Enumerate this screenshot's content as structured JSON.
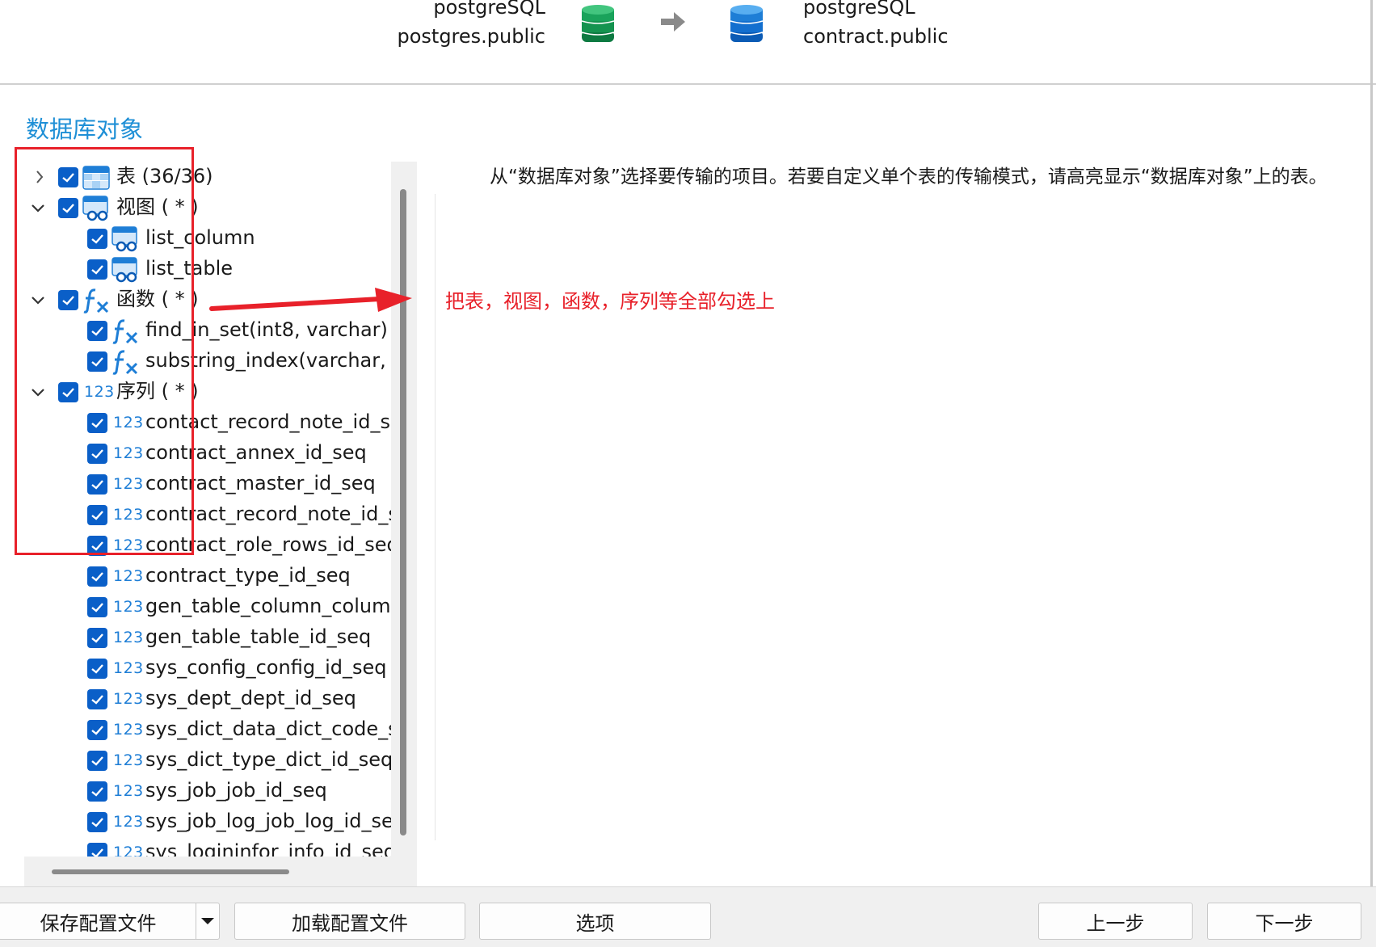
{
  "header": {
    "source_server": "postgreSQL",
    "source_schema": "postgres.public",
    "target_server": "postgreSQL",
    "target_schema": "contract.public",
    "source_color": "#1aa35b",
    "target_color": "#1e7ed6"
  },
  "section_title": "数据库对象",
  "tree": {
    "tables": {
      "label": "表 (36/36)",
      "expanded": false,
      "checked": true
    },
    "views": {
      "label": "视图 ( * )",
      "expanded": true,
      "checked": true,
      "items": [
        "list_column",
        "list_table"
      ]
    },
    "functions": {
      "label": "函数 ( * )",
      "expanded": true,
      "checked": true,
      "items": [
        "find_in_set(int8, varchar)",
        "substring_index(varchar, v"
      ]
    },
    "sequences": {
      "label": "序列 ( * )",
      "expanded": true,
      "checked": true,
      "icon_text": "123",
      "items": [
        "contact_record_note_id_se",
        "contract_annex_id_seq",
        "contract_master_id_seq",
        "contract_record_note_id_s",
        "contract_role_rows_id_seq",
        "contract_type_id_seq",
        "gen_table_column_column",
        "gen_table_table_id_seq",
        "sys_config_config_id_seq",
        "sys_dept_dept_id_seq",
        "sys_dict_data_dict_code_se",
        "sys_dict_type_dict_id_seq",
        "sys_job_job_id_seq",
        "sys_job_log_job_log_id_sec",
        "sys_logininfor_info_id_seq"
      ]
    }
  },
  "description": "从“数据库对象”选择要传输的项目。若要自定义单个表的传输模式，请高亮显示“数据库对象”上的表。",
  "annotation": "把表，视图，函数，序列等全部勾选上",
  "buttons": {
    "save": "保存配置文件",
    "load": "加载配置文件",
    "options": "选项",
    "prev": "上一步",
    "next": "下一步"
  },
  "colors": {
    "accent": "#1e8fd6",
    "checkbox": "#0a5fc8",
    "annotation_red": "#e8212a"
  }
}
